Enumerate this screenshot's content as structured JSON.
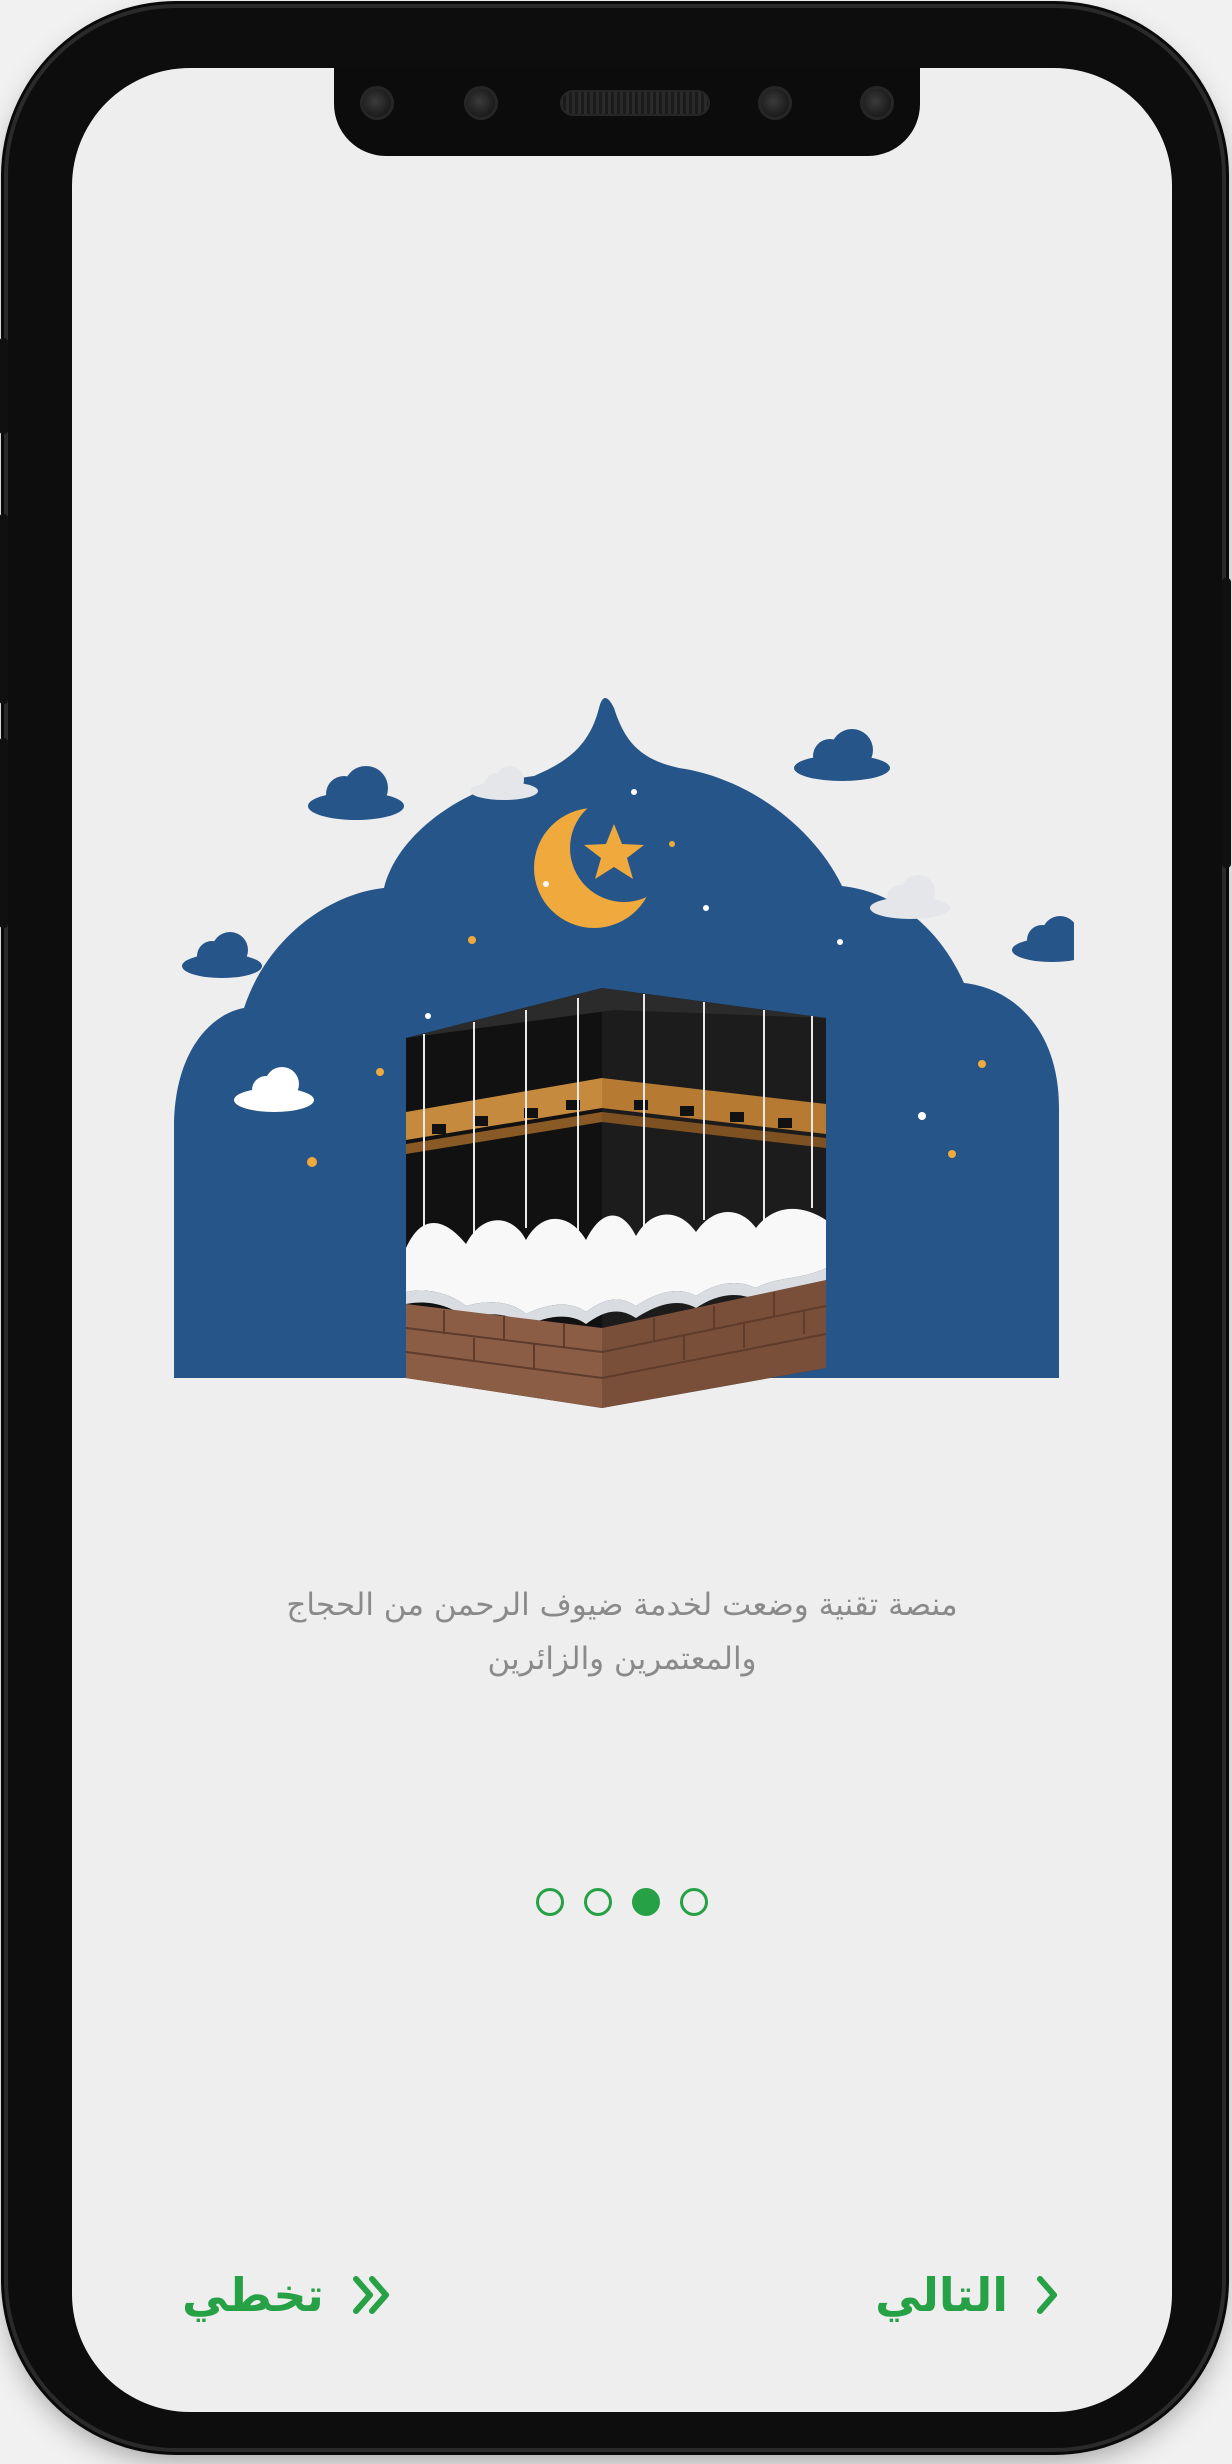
{
  "onboarding": {
    "description_line1": "منصة تقنية وضعت لخدمة ضيوف الرحمن من الحجاج",
    "description_line2": "والمعتمرين والزائرين",
    "pagination": {
      "total": 4,
      "active_index": 3
    },
    "skip_label": "تخطي",
    "next_label": "التالي"
  },
  "colors": {
    "accent_green": "#27a146",
    "night_blue": "#26558a",
    "moon_gold": "#f0a93c",
    "kiswa_black": "#111111",
    "belt_gold": "#c68a3e",
    "brick_brown": "#8b5d45"
  },
  "icons": {
    "illustration": "kaaba-night-illustration",
    "skip": "double-chevron-right-icon",
    "next": "chevron-right-icon"
  }
}
